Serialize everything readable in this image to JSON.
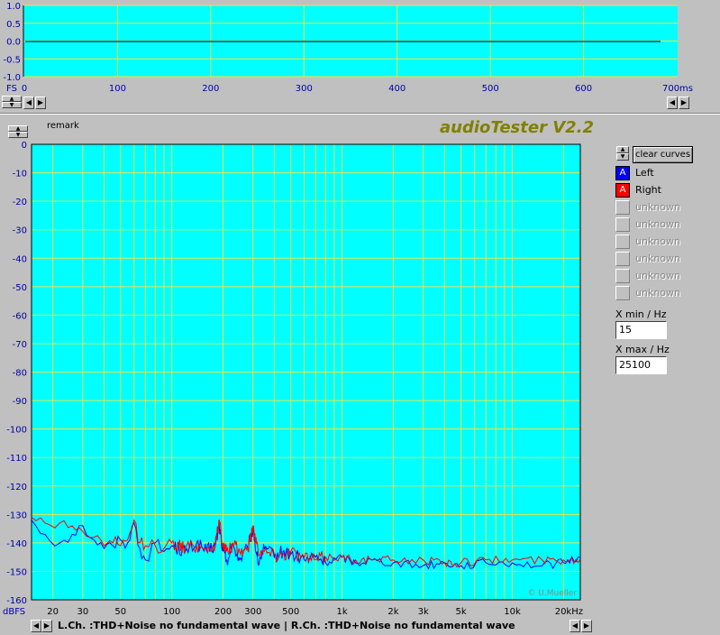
{
  "scope": {
    "y_ticks": [
      "1.0",
      "0.5",
      "0.0",
      "-0.5",
      "-1.0"
    ],
    "x_unit_left": "FS",
    "x_ticks": [
      "0",
      "100",
      "200",
      "300",
      "400",
      "500",
      "600",
      "700ms"
    ]
  },
  "remark_label": "remark",
  "app_title": "audioTester V2.2",
  "clear_curves_label": "clear curves",
  "channels": [
    {
      "glyph": "A",
      "label": "Left",
      "color": "#0000ff",
      "enabled": true
    },
    {
      "glyph": "A",
      "label": "Right",
      "color": "#ff0000",
      "enabled": true
    },
    {
      "glyph": "",
      "label": "unknown",
      "color": "#c0c0c0",
      "enabled": false
    },
    {
      "glyph": "",
      "label": "unknown",
      "color": "#c0c0c0",
      "enabled": false
    },
    {
      "glyph": "",
      "label": "unknown",
      "color": "#c0c0c0",
      "enabled": false
    },
    {
      "glyph": "",
      "label": "unknown",
      "color": "#c0c0c0",
      "enabled": false
    },
    {
      "glyph": "",
      "label": "unknown",
      "color": "#c0c0c0",
      "enabled": false
    },
    {
      "glyph": "",
      "label": "unknown",
      "color": "#c0c0c0",
      "enabled": false
    }
  ],
  "xmin": {
    "label": "X min / Hz",
    "value": "15"
  },
  "xmax": {
    "label": "X max / Hz",
    "value": "25100"
  },
  "status_text": "L.Ch. :THD+Noise  no fundamental wave | R.Ch. :THD+Noise  no fundamental wave",
  "credit": "© U.Mueller",
  "colors": {
    "plot_bg": "#00ffff",
    "grid": "#e6e64a",
    "axis_text": "#0000aa",
    "title": "#808000"
  },
  "chart_data": [
    {
      "type": "line",
      "x": [
        0,
        700
      ],
      "ylim": [
        -1.0,
        1.0
      ],
      "xlim": [
        0,
        700
      ],
      "y_tick_labels": [
        "1.0",
        "0.5",
        "0.0",
        "-0.5",
        "-1.0"
      ],
      "x_tick_labels": [
        "0",
        "100",
        "200",
        "300",
        "400",
        "500",
        "600",
        "700ms"
      ],
      "series": [
        {
          "values": [
            0.0,
            0.0
          ]
        }
      ]
    },
    {
      "type": "line",
      "xscale": "log",
      "xlim": [
        15,
        25100
      ],
      "ylim": [
        -160,
        0
      ],
      "ylabel": "dBFS",
      "xlabel": "kHz",
      "y_tick_labels": [
        "0",
        "-10",
        "-20",
        "-30",
        "-40",
        "-50",
        "-60",
        "-70",
        "-80",
        "-90",
        "-100",
        "-110",
        "-120",
        "-130",
        "-140",
        "-150",
        "-160"
      ],
      "x_tick_labels": [
        "20",
        "30",
        "50",
        "100",
        "200",
        "300",
        "500",
        "1k",
        "2k",
        "3k",
        "5k",
        "10k",
        "20kHz"
      ],
      "x": [
        15,
        18,
        22,
        26,
        30,
        35,
        40,
        45,
        50,
        55,
        60,
        65,
        70,
        80,
        90,
        100,
        110,
        120,
        140,
        160,
        180,
        190,
        200,
        210,
        230,
        250,
        280,
        300,
        320,
        350,
        400,
        450,
        500,
        600,
        700,
        800,
        1000,
        1200,
        1500,
        2000,
        3000,
        4000,
        5000,
        7000,
        10000,
        15000,
        20000,
        25000
      ],
      "series": [
        {
          "name": "Left",
          "color": "#0000ff",
          "values": [
            -132,
            -137,
            -140,
            -137,
            -134,
            -139,
            -142,
            -141,
            -139,
            -140,
            -133,
            -142,
            -146,
            -140,
            -143,
            -141,
            -142,
            -143,
            -140,
            -143,
            -141,
            -134,
            -143,
            -146,
            -141,
            -146,
            -142,
            -135,
            -147,
            -142,
            -145,
            -143,
            -144,
            -146,
            -145,
            -147,
            -145,
            -147,
            -146,
            -147,
            -148,
            -147,
            -148,
            -147,
            -147,
            -148,
            -147,
            -145
          ]
        },
        {
          "name": "Right",
          "color": "#ff0000",
          "values": [
            -131,
            -133,
            -133,
            -134,
            -136,
            -138,
            -141,
            -140,
            -141,
            -139,
            -132,
            -140,
            -141,
            -141,
            -142,
            -140,
            -141,
            -142,
            -141,
            -142,
            -141,
            -132,
            -141,
            -143,
            -141,
            -143,
            -142,
            -134,
            -142,
            -143,
            -144,
            -144,
            -143,
            -145,
            -146,
            -145,
            -145,
            -146,
            -146,
            -146,
            -146,
            -147,
            -147,
            -146,
            -146,
            -146,
            -146,
            -146
          ]
        }
      ]
    }
  ]
}
